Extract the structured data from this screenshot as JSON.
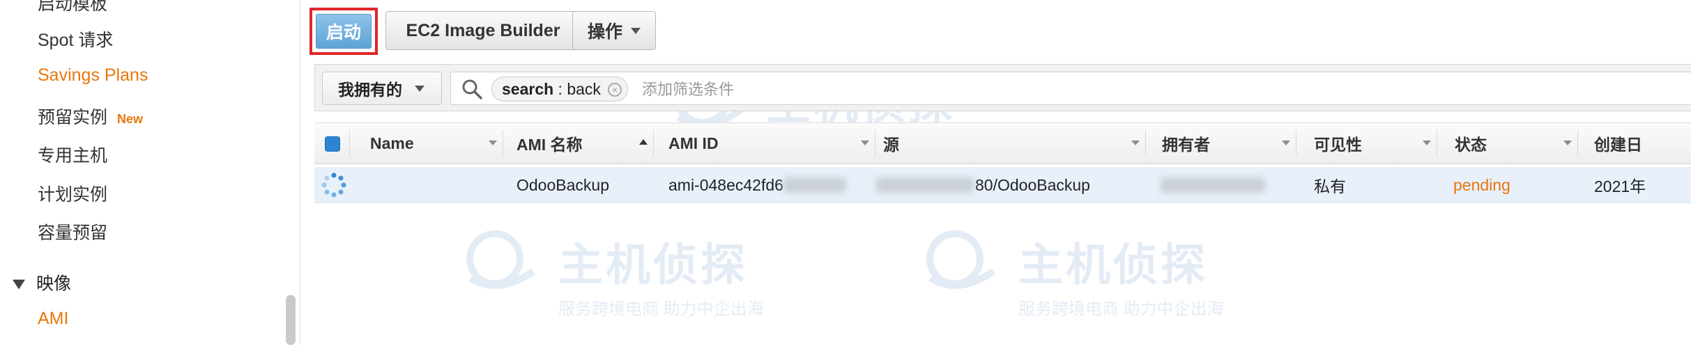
{
  "sidebar": {
    "items": [
      {
        "label": "启动模板",
        "active": false
      },
      {
        "label": "Spot 请求",
        "active": false
      },
      {
        "label": "Savings Plans",
        "active": true
      },
      {
        "label": "预留实例",
        "badge": "New",
        "active": false
      },
      {
        "label": "专用主机",
        "active": false
      },
      {
        "label": "计划实例",
        "active": false
      },
      {
        "label": "容量预留",
        "active": false
      }
    ],
    "section": {
      "label": "映像",
      "icon": "triangle-down-icon"
    },
    "section_items": [
      {
        "label": "AMI",
        "active": true
      }
    ]
  },
  "toolbar": {
    "launch_label": "启动",
    "builder_label": "EC2 Image Builder",
    "actions_label": "操作"
  },
  "filter": {
    "owner_select": "我拥有的",
    "token_key": "search",
    "token_sep": " : ",
    "token_value": "back",
    "placeholder": "添加筛选条件"
  },
  "table": {
    "columns": [
      "Name",
      "AMI 名称",
      "AMI ID",
      "源",
      "拥有者",
      "可见性",
      "状态",
      "创建日"
    ],
    "sorted_column": "AMI 名称",
    "rows": [
      {
        "name": "",
        "ami_name": "OdooBackup",
        "ami_id": "ami-048ec42fd6",
        "source_suffix": "80/OdooBackup",
        "owner": "",
        "visibility": "私有",
        "status": "pending",
        "created": "2021年"
      }
    ]
  },
  "watermark": {
    "title": "主机侦探",
    "subtitle": "服务跨境电商 助力中企出海"
  },
  "colors": {
    "accent_orange": "#e8770c",
    "primary_blue": "#5ea3d6",
    "highlight_red": "#e0262a",
    "row_selected": "#e8f1fa"
  }
}
